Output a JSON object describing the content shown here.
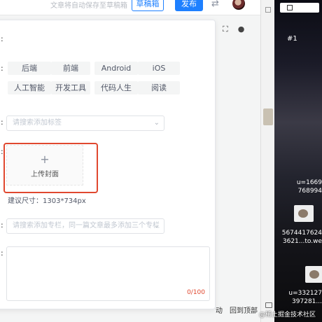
{
  "topbar": {
    "autosave_text": "文章将自动保存至草稿箱",
    "draft_button": "草稿箱",
    "publish_button": "发布"
  },
  "panel": {
    "category_tags": [
      "后端",
      "前端",
      "Android",
      "iOS",
      "人工智能",
      "开发工具",
      "代码人生",
      "阅读"
    ],
    "tag_placeholder": "请搜索添加标签",
    "cover_plus": "+",
    "cover_label": "上传封面",
    "cover_size_hint": "建议尺寸：1303*734px",
    "column_placeholder": "请搜索添加专栏，同一篇文章最多添加三个专栏",
    "summary_count": "0/100"
  },
  "bottom": {
    "back_to_top": "回到顶部",
    "partial_label": "动"
  },
  "video_panel": {
    "number": "#1",
    "danmaku": [
      "u=1669",
      "768994",
      "5674417624",
      "3621...to.we",
      "u=332127",
      "397281..."
    ]
  },
  "watermark": "@稀土掘金技术社区"
}
